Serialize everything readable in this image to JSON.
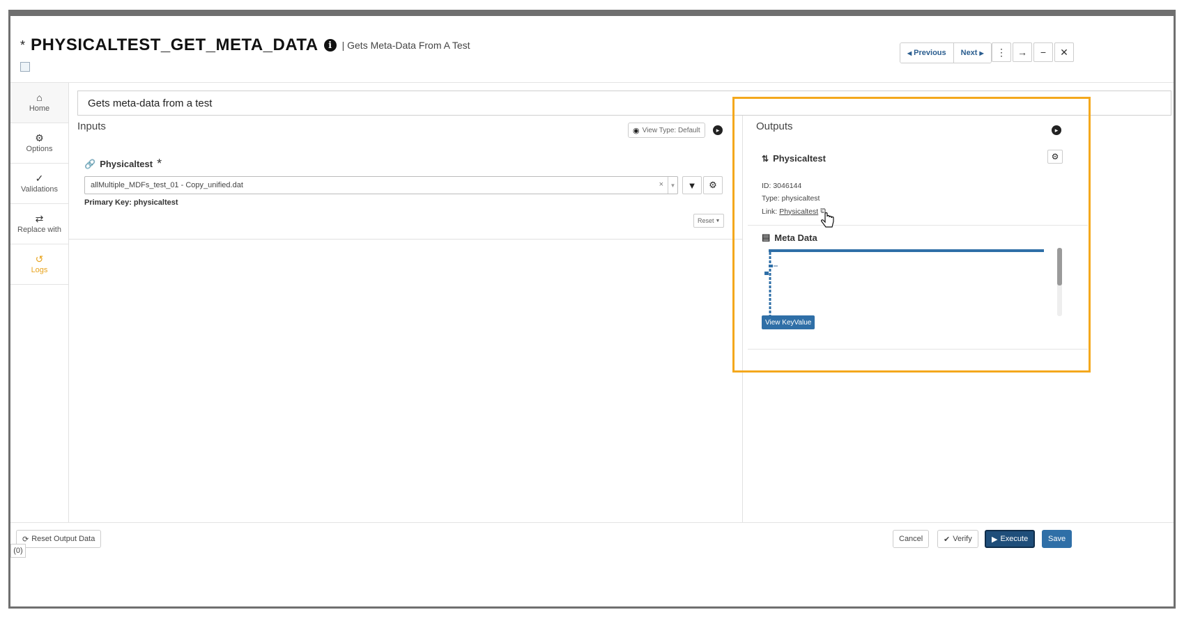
{
  "header": {
    "modified_marker": "*",
    "title": "PHYSICALTEST_GET_META_DATA",
    "subtitle": "| Gets Meta-Data From A Test",
    "prev_label": "Previous",
    "next_label": "Next"
  },
  "sidebar": {
    "items": [
      {
        "label": "Home",
        "icon": "home-icon"
      },
      {
        "label": "Options",
        "icon": "gear-icon"
      },
      {
        "label": "Validations",
        "icon": "check-icon"
      },
      {
        "label": "Replace with",
        "icon": "swap-icon"
      },
      {
        "label": "Logs",
        "icon": "history-icon"
      }
    ]
  },
  "description": "Gets meta-data from a test",
  "inputs": {
    "title": "Inputs",
    "view_type": "View Type: Default",
    "field_label": "Physicaltest",
    "required_marker": "*",
    "selected_value": "allMultiple_MDFs_test_01 - Copy_unified.dat",
    "clear_glyph": "×",
    "primary_key": "Primary Key: physicaltest",
    "reset_label": "Reset"
  },
  "outputs": {
    "title": "Outputs",
    "name": "Physicaltest",
    "id": "ID: 3046144",
    "type": "Type: physicaltest",
    "link_prefix": "Link:",
    "link_text": "Physicaltest",
    "meta_title": "Meta Data",
    "kv_button": "View KeyValue"
  },
  "footer": {
    "reset_output": "Reset Output Data",
    "cancel": "Cancel",
    "verify": "Verify",
    "execute": "Execute",
    "save": "Save",
    "counter": "(0)"
  },
  "colors": {
    "accent": "#2f6fa7",
    "highlight": "#f4a81d",
    "logs": "#e8a31c"
  }
}
